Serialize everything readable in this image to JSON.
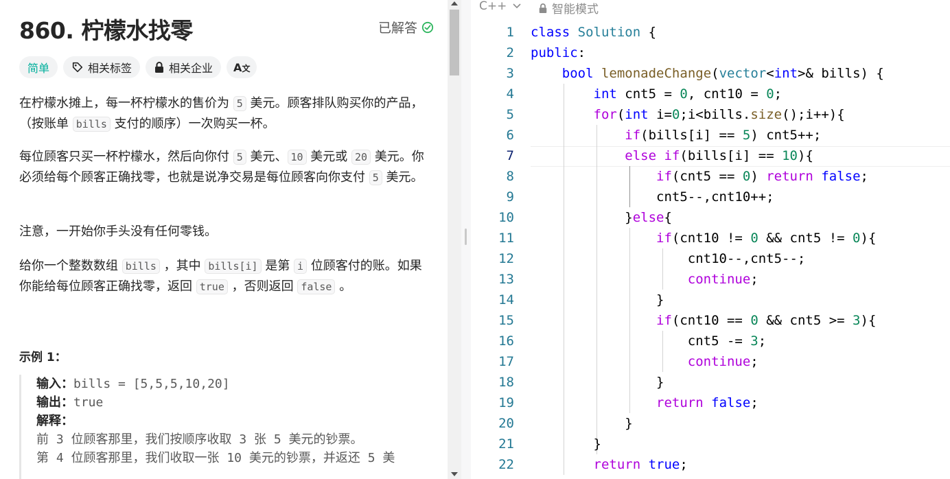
{
  "problem": {
    "title": "860. 柠檬水找零",
    "status": "已解答",
    "tags": [
      "简单",
      "相关标签",
      "相关企业"
    ],
    "desc": {
      "p1_a": "在柠檬水摊上，每一杯柠檬水的售价为 ",
      "p1_code1": "5",
      "p1_b": " 美元。顾客排队购买你的产品，（按账单 ",
      "p1_code2": "bills",
      "p1_c": " 支付的顺序）一次购买一杯。",
      "p2_a": "每位顾客只买一杯柠檬水，然后向你付 ",
      "p2_code1": "5",
      "p2_b": " 美元、",
      "p2_code2": "10",
      "p2_c": " 美元或 ",
      "p2_code3": "20",
      "p2_d": " 美元。你必须给每个顾客正确找零，也就是说净交易是每位顾客向你支付 ",
      "p2_code4": "5",
      "p2_e": " 美元。",
      "p3": "注意，一开始你手头没有任何零钱。",
      "p4_a": "给你一个整数数组 ",
      "p4_code1": "bills",
      "p4_b": " ，其中 ",
      "p4_code2": "bills[i]",
      "p4_c": " 是第 ",
      "p4_code3": "i",
      "p4_d": " 位顾客付的账。如果你能给每位顾客正确找零，返回 ",
      "p4_code4": "true",
      "p4_e": " ，否则返回 ",
      "p4_code5": "false",
      "p4_f": " 。"
    },
    "example": {
      "title": "示例 1：",
      "input_label": "输入：",
      "input_value": "bills = [5,5,5,10,20]",
      "output_label": "输出：",
      "output_value": "true",
      "explain_label": "解释：",
      "explain_1": "前 3 位顾客那里，我们按顺序收取 3 张 5 美元的钞票。",
      "explain_2": "第 4 位顾客那里，我们收取一张 10 美元的钞票，并返还 5 美"
    }
  },
  "editor": {
    "language": "C++",
    "mode": "智能模式",
    "line_numbers": [
      "1",
      "2",
      "3",
      "4",
      "5",
      "6",
      "7",
      "8",
      "9",
      "10",
      "11",
      "12",
      "13",
      "14",
      "15",
      "16",
      "17",
      "18",
      "19",
      "20",
      "21",
      "22"
    ]
  },
  "colors": {
    "easy": "#00af9b",
    "solved_check": "#2db55d",
    "keyword": "#0000ff",
    "control": "#af00db",
    "type": "#267f99",
    "function": "#795e26",
    "number": "#098658",
    "line_number": "#237893"
  }
}
